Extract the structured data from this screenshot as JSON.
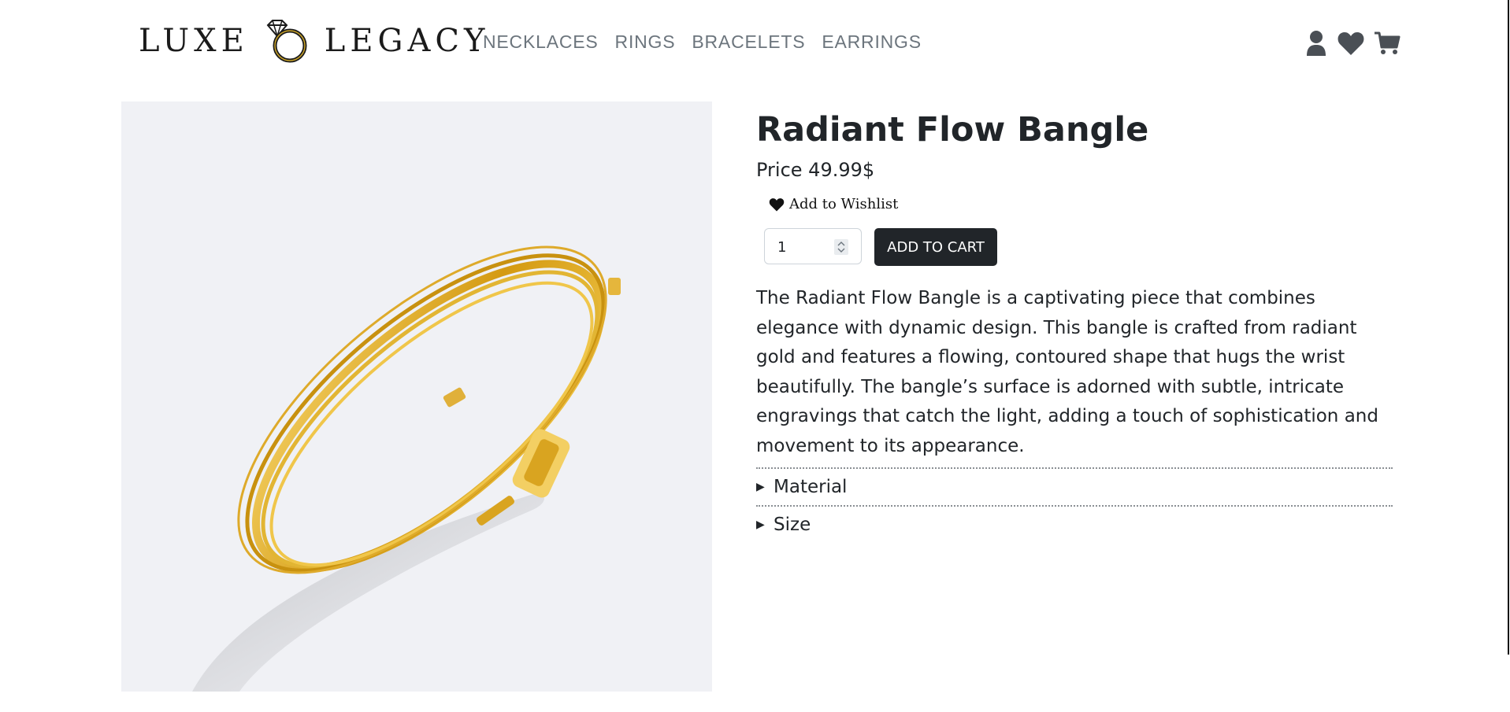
{
  "header": {
    "logo": {
      "left": "LUXE",
      "right": "LEGACY",
      "icon": "diamond-ring-icon"
    },
    "nav": [
      "NECKLACES",
      "RINGS",
      "BRACELETS",
      "EARRINGS"
    ],
    "icons": [
      "user-icon",
      "heart-icon",
      "cart-icon"
    ]
  },
  "product": {
    "title": "Radiant Flow Bangle",
    "price": "Price 49.99$",
    "wishlist_label": "Add to Wishlist",
    "quantity": "1",
    "add_to_cart_label": "ADD TO CART",
    "description": "The Radiant Flow Bangle is a captivating piece that combines elegance with dynamic design. This bangle is crafted from radiant gold and features a flowing, contoured shape that hugs the wrist beautifully. The bangle’s surface is adorned with subtle, intricate engravings that catch the light, adding a touch of sophistication and movement to its appearance.",
    "accordion": [
      {
        "label": "Material",
        "expanded": false
      },
      {
        "label": "Size",
        "expanded": false
      }
    ]
  },
  "colors": {
    "text": "#212529",
    "nav": "#6c757d",
    "button": "#212529",
    "image_bg": "#f0f1f5",
    "gold": "#d9a11c"
  }
}
